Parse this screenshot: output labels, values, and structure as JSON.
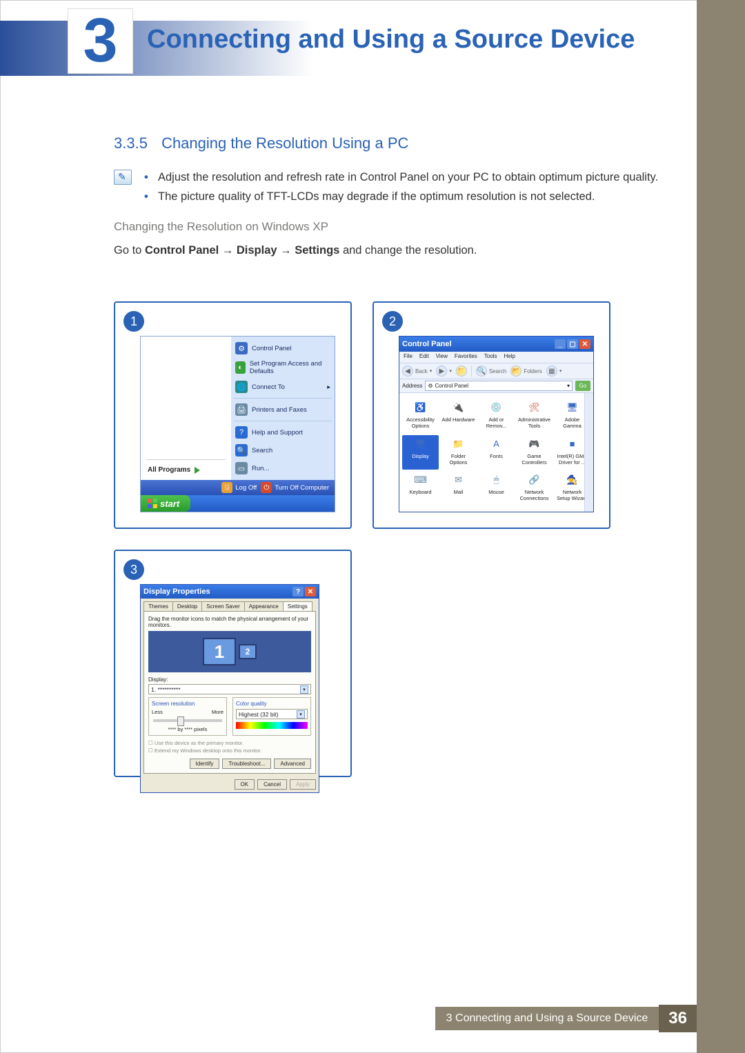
{
  "chapter": {
    "num": "3",
    "title": "Connecting and Using a Source Device"
  },
  "section": {
    "num": "3.3.5",
    "title": "Changing the Resolution Using a PC",
    "notes": [
      "Adjust the resolution and refresh rate in Control Panel on your PC to obtain optimum picture quality.",
      "The picture quality of TFT-LCDs may degrade if the optimum resolution is not selected."
    ],
    "subsection": "Changing the Resolution on Windows XP",
    "instruction_prefix": "Go to ",
    "instruction_path": "Control Panel → Display → Settings",
    "instruction_suffix": " and change the resolution."
  },
  "shot1": {
    "num": "1",
    "right_items": [
      {
        "label": "Control Panel",
        "color": "#3a6ac2",
        "glyph": "⚙"
      },
      {
        "label": "Set Program Access and Defaults",
        "color": "#3aa23a",
        "glyph": "◐"
      },
      {
        "label": "Connect To",
        "color": "#2a8a8a",
        "glyph": "🌐",
        "arrow": "▸"
      }
    ],
    "right_items2": [
      {
        "label": "Printers and Faxes",
        "color": "#6a8aa4",
        "glyph": "🖨"
      }
    ],
    "right_items3": [
      {
        "label": "Help and Support",
        "color": "#2a6ad2",
        "glyph": "?"
      },
      {
        "label": "Search",
        "color": "#2a6ad2",
        "glyph": "🔍"
      },
      {
        "label": "Run...",
        "color": "#6a8aa4",
        "glyph": "▭"
      }
    ],
    "all_programs": "All Programs",
    "logoff": "Log Off",
    "shutdown": "Turn Off Computer",
    "start": "start"
  },
  "shot2": {
    "num": "2",
    "title": "Control Panel",
    "menus": [
      "File",
      "Edit",
      "View",
      "Favorites",
      "Tools",
      "Help"
    ],
    "toolbar": {
      "back": "Back",
      "search": "Search",
      "folders": "Folders"
    },
    "address_label": "Address",
    "address_value": "Control Panel",
    "go": "Go",
    "items": [
      {
        "label": "Accessibility Options",
        "glyph": "♿",
        "color": "#3aa23a"
      },
      {
        "label": "Add Hardware",
        "glyph": "🔌",
        "color": "#6a8aa4"
      },
      {
        "label": "Add or Remov...",
        "glyph": "💿",
        "color": "#c78a3a"
      },
      {
        "label": "Administrative Tools",
        "glyph": "🛠",
        "color": "#c74a3a"
      },
      {
        "label": "Adobe Gamma",
        "glyph": "🖥",
        "color": "#3a6ac2"
      },
      {
        "label": "Display",
        "glyph": "🖥",
        "color": "#3a6ac2",
        "selected": true
      },
      {
        "label": "Folder Options",
        "glyph": "📁",
        "color": "#d8b24a"
      },
      {
        "label": "Fonts",
        "glyph": "A",
        "color": "#3a6ac2"
      },
      {
        "label": "Game Controllers",
        "glyph": "🎮",
        "color": "#8a8a4a"
      },
      {
        "label": "Intel(R) GMA Driver for ...",
        "glyph": "■",
        "color": "#3a6ac2"
      },
      {
        "label": "Keyboard",
        "glyph": "⌨",
        "color": "#6a8aa4"
      },
      {
        "label": "Mail",
        "glyph": "✉",
        "color": "#6a8aa4"
      },
      {
        "label": "Mouse",
        "glyph": "🖱",
        "color": "#6a8aa4"
      },
      {
        "label": "Network Connections",
        "glyph": "🔗",
        "color": "#3a8a6a"
      },
      {
        "label": "Network Setup Wizard",
        "glyph": "🧙",
        "color": "#3a8a6a"
      }
    ]
  },
  "shot3": {
    "num": "3",
    "title": "Display Properties",
    "tabs": [
      "Themes",
      "Desktop",
      "Screen Saver",
      "Appearance",
      "Settings"
    ],
    "active_tab": "Settings",
    "hint": "Drag the monitor icons to match the physical arrangement of your monitors.",
    "display_label": "Display:",
    "display_value": "1. **********",
    "res_group": "Screen resolution",
    "res_less": "Less",
    "res_more": "More",
    "res_value": "**** by **** pixels",
    "color_group": "Color quality",
    "color_value": "Highest (32 bit)",
    "check1": "Use this device as the primary monitor.",
    "check2": "Extend my Windows desktop onto this monitor.",
    "btn_identify": "Identify",
    "btn_troubleshoot": "Troubleshoot...",
    "btn_advanced": "Advanced",
    "btn_ok": "OK",
    "btn_cancel": "Cancel",
    "btn_apply": "Apply"
  },
  "footer": {
    "label": "3 Connecting and Using a Source Device",
    "page": "36"
  }
}
